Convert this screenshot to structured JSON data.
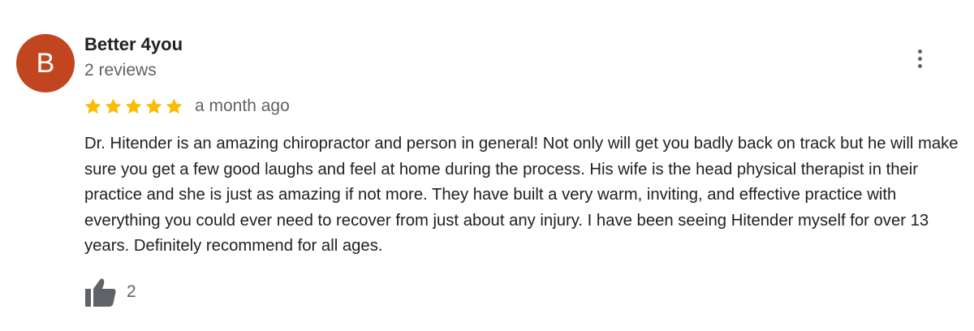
{
  "review": {
    "avatar_letter": "B",
    "avatar_color": "#c1461f",
    "reviewer_name": "Better 4you",
    "review_count": "2 reviews",
    "more_options_icon": "more-vertical-icon",
    "rating": 5,
    "rating_max": 5,
    "star_color": "#fbbc04",
    "date": "a month ago",
    "text": "Dr. Hitender is an amazing chiropractor and person in general! Not only will get you badly back on track but he will make sure you get a few good laughs and feel at home during the process. His wife is the head physical therapist in their practice and she is just as amazing if not more. They have built a very warm, inviting, and effective practice with everything you could ever need to recover from just about any injury. I have been seeing Hitender myself for over 13 years. Definitely recommend for all ages.",
    "like_icon": "thumbs-up-icon",
    "like_count": "2"
  }
}
